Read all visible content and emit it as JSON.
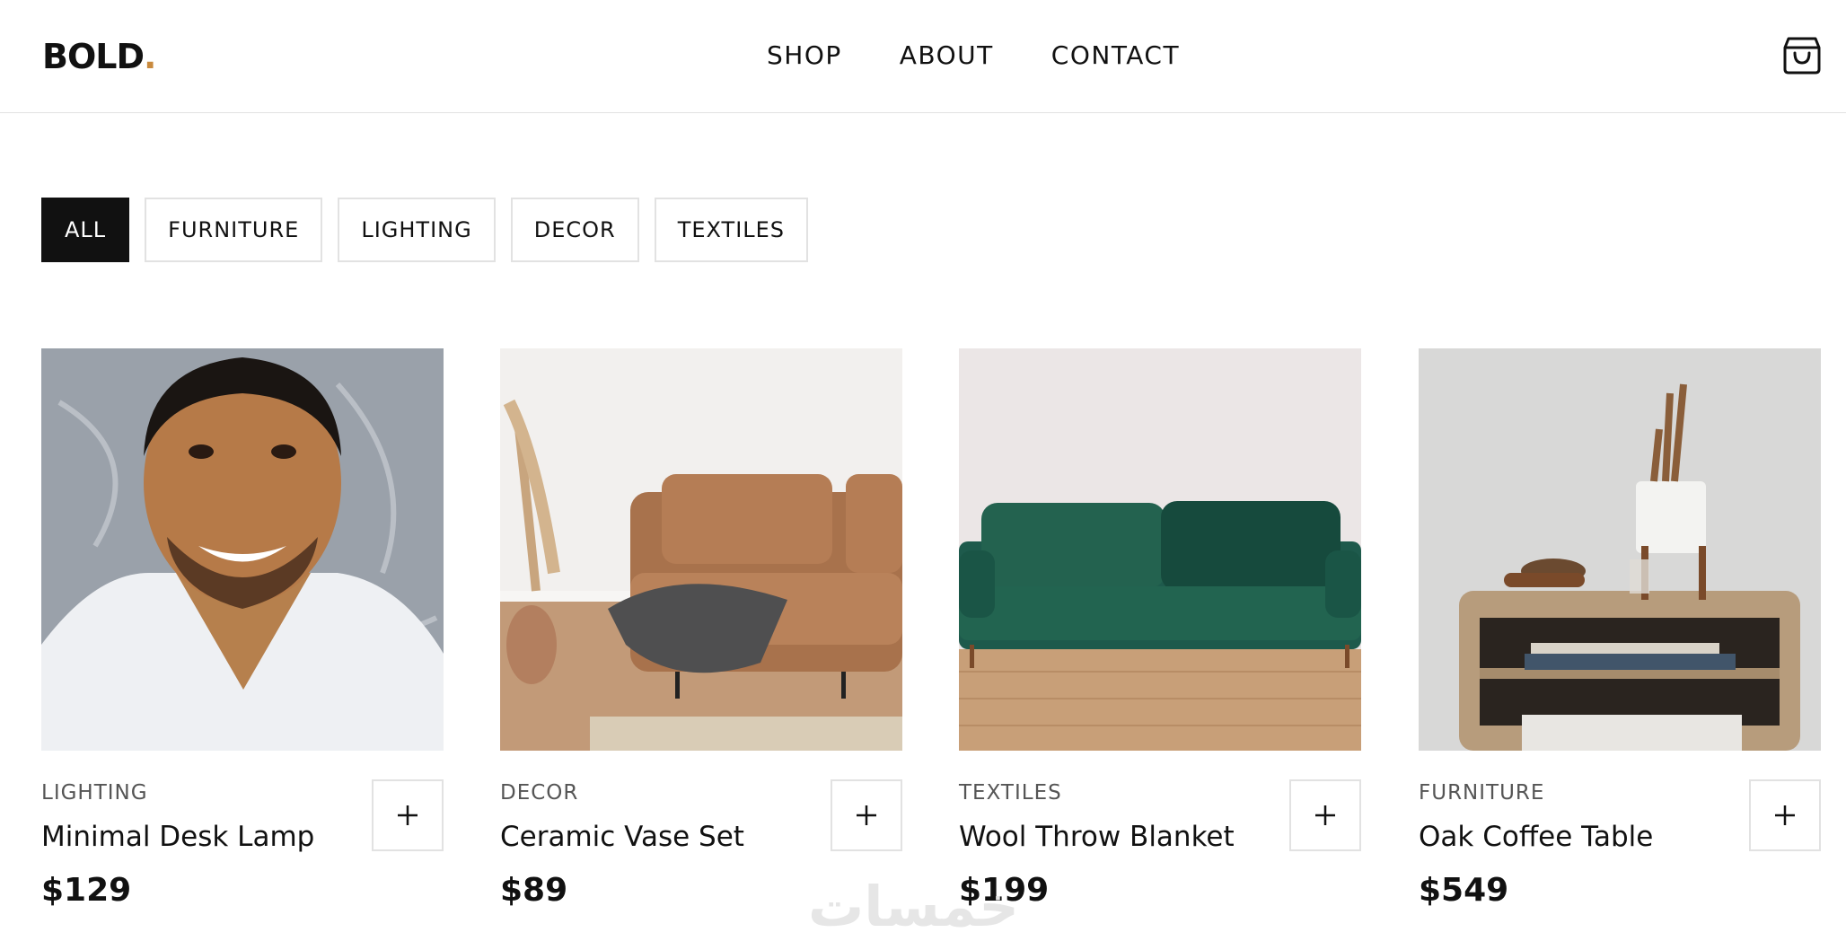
{
  "header": {
    "logo_text": "BOLD",
    "logo_dot": ".",
    "nav": [
      "SHOP",
      "ABOUT",
      "CONTACT"
    ],
    "cart_icon": "shopping-bag-icon"
  },
  "filters": {
    "active": "ALL",
    "items": [
      "ALL",
      "FURNITURE",
      "LIGHTING",
      "DECOR",
      "TEXTILES"
    ]
  },
  "products": [
    {
      "category": "LIGHTING",
      "name": "Minimal Desk Lamp",
      "price": "$129",
      "image": "portrait-photo",
      "add_icon": "plus-icon"
    },
    {
      "category": "DECOR",
      "name": "Ceramic Vase Set",
      "price": "$89",
      "image": "tan-sofa-photo",
      "add_icon": "plus-icon"
    },
    {
      "category": "TEXTILES",
      "name": "Wool Throw Blanket",
      "price": "$199",
      "image": "green-sofa-photo",
      "add_icon": "plus-icon"
    },
    {
      "category": "FURNITURE",
      "name": "Oak Coffee Table",
      "price": "$549",
      "image": "wooden-side-table-photo",
      "add_icon": "plus-icon"
    }
  ],
  "watermark": "خمسات",
  "colors": {
    "accent": "#c98a3e",
    "text": "#111111",
    "border": "#e2e2e2",
    "active_chip": "#111111"
  }
}
